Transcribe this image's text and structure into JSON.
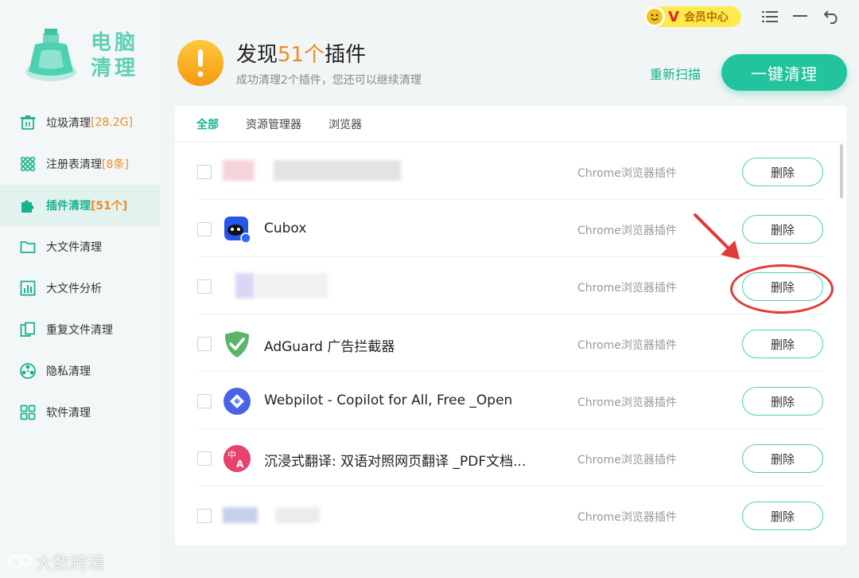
{
  "app": {
    "logo_text_line1": "电脑",
    "logo_text_line2": "清理"
  },
  "sidebar": {
    "items": [
      {
        "label": "垃圾清理",
        "count": "[28.2G]",
        "icon": "trash-icon"
      },
      {
        "label": "注册表清理",
        "count": "[8条]",
        "icon": "registry-grid-icon"
      },
      {
        "label": "插件清理",
        "count": "[51个]",
        "icon": "puzzle-icon",
        "active": true
      },
      {
        "label": "大文件清理",
        "count": "",
        "icon": "folder-icon"
      },
      {
        "label": "大文件分析",
        "count": "",
        "icon": "chart-icon"
      },
      {
        "label": "重复文件清理",
        "count": "",
        "icon": "duplicate-icon"
      },
      {
        "label": "隐私清理",
        "count": "",
        "icon": "privacy-icon"
      },
      {
        "label": "软件清理",
        "count": "",
        "icon": "apps-icon"
      }
    ]
  },
  "topbar": {
    "vip_label": "会员中心",
    "vip_letter": "V"
  },
  "header": {
    "title_prefix": "发现",
    "title_count": "51个",
    "title_suffix": "插件",
    "subtitle": "成功清理2个插件，您还可以继续清理",
    "rescan_label": "重新扫描",
    "clean_label": "一键清理"
  },
  "tabs": [
    {
      "label": "全部",
      "active": true
    },
    {
      "label": "资源管理器"
    },
    {
      "label": "浏览器"
    }
  ],
  "plugins": [
    {
      "name": "",
      "type": "Chrome浏览器插件",
      "action": "删除",
      "blurred": true
    },
    {
      "name": "Cubox",
      "type": "Chrome浏览器插件",
      "action": "删除"
    },
    {
      "name": "",
      "type": "Chrome浏览器插件",
      "action": "删除",
      "blurred": true
    },
    {
      "name": "AdGuard 广告拦截器",
      "type": "Chrome浏览器插件",
      "action": "删除"
    },
    {
      "name": "Webpilot - Copilot for All, Free _Open",
      "type": "Chrome浏览器插件",
      "action": "删除"
    },
    {
      "name": "沉浸式翻译: 双语对照网页翻译 _PDF文档...",
      "type": "Chrome浏览器插件",
      "action": "删除"
    },
    {
      "name": "",
      "type": "Chrome浏览器插件",
      "action": "删除",
      "blurred": true
    }
  ],
  "watermark": "大数跨境",
  "colors": {
    "accent": "#22c39d",
    "warning": "#f08a24",
    "annotation": "#e23a3a"
  }
}
